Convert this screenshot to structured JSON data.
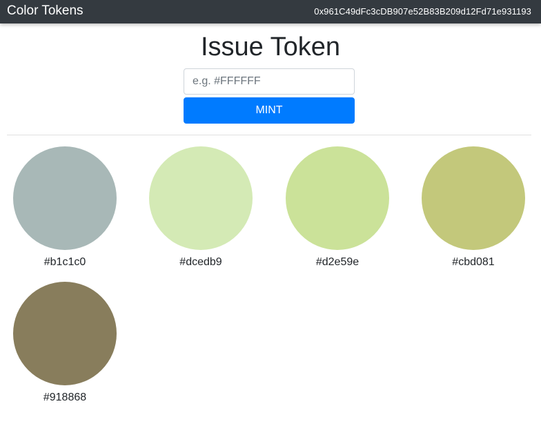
{
  "navbar": {
    "brand": "Color Tokens",
    "account": "0x961C49dFc3cDB907e52B83B209d12Fd71e931193"
  },
  "form": {
    "title": "Issue Token",
    "input_placeholder": "e.g. #FFFFFF",
    "input_value": "",
    "mint_label": "MINT"
  },
  "colors": {
    "primary": "#007bff",
    "navbar_bg": "#343a40"
  },
  "tokens": [
    {
      "label": "#b1c1c0",
      "color": "#a8b8b7"
    },
    {
      "label": "#dcedb9",
      "color": "#d4eab5"
    },
    {
      "label": "#d2e59e",
      "color": "#cbe299"
    },
    {
      "label": "#cbd081",
      "color": "#c3c87b"
    },
    {
      "label": "#918868",
      "color": "#887d5c"
    }
  ]
}
